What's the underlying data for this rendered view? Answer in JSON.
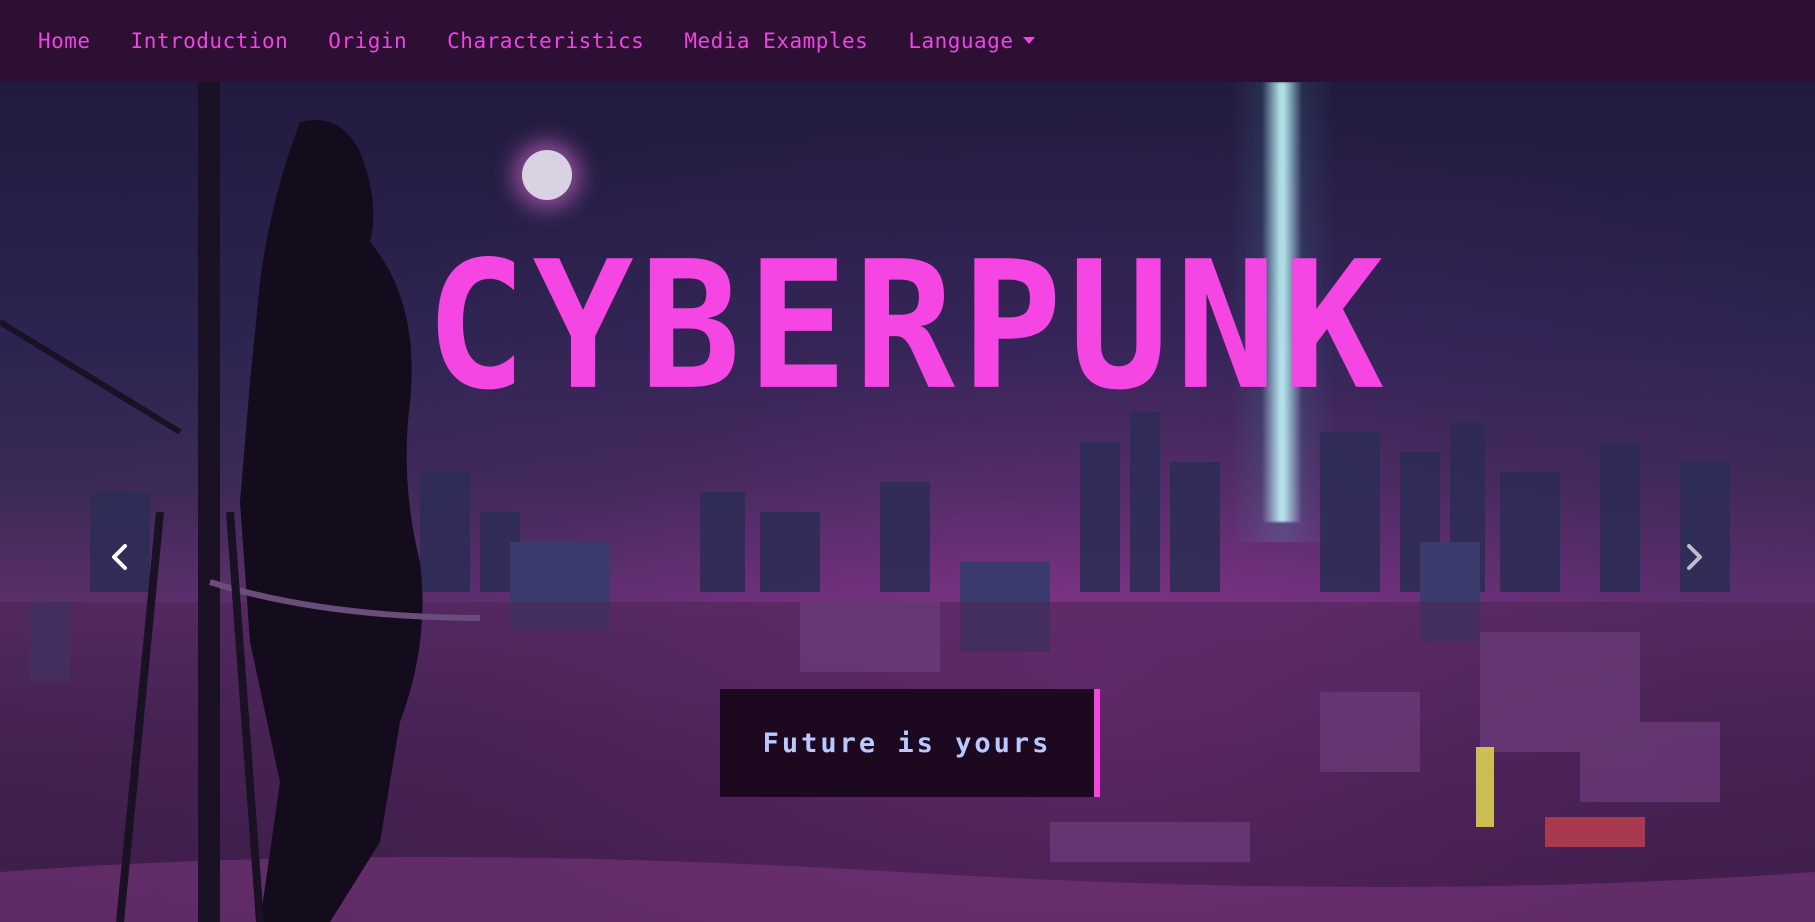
{
  "navbar": {
    "items": [
      "Home",
      "Introduction",
      "Origin",
      "Characteristics",
      "Media Examples"
    ],
    "language_label": "Language"
  },
  "hero": {
    "title": "CYBERPUNK",
    "tagline": "Future is yours"
  },
  "colors": {
    "accent": "#f545e3",
    "navbar_bg": "#2d0f33",
    "tagline_bg": "#1c0920",
    "tagline_text": "#b9c8ff"
  },
  "icons": {
    "prev": "chevron-left-icon",
    "next": "chevron-right-icon",
    "dropdown": "caret-down-icon"
  }
}
